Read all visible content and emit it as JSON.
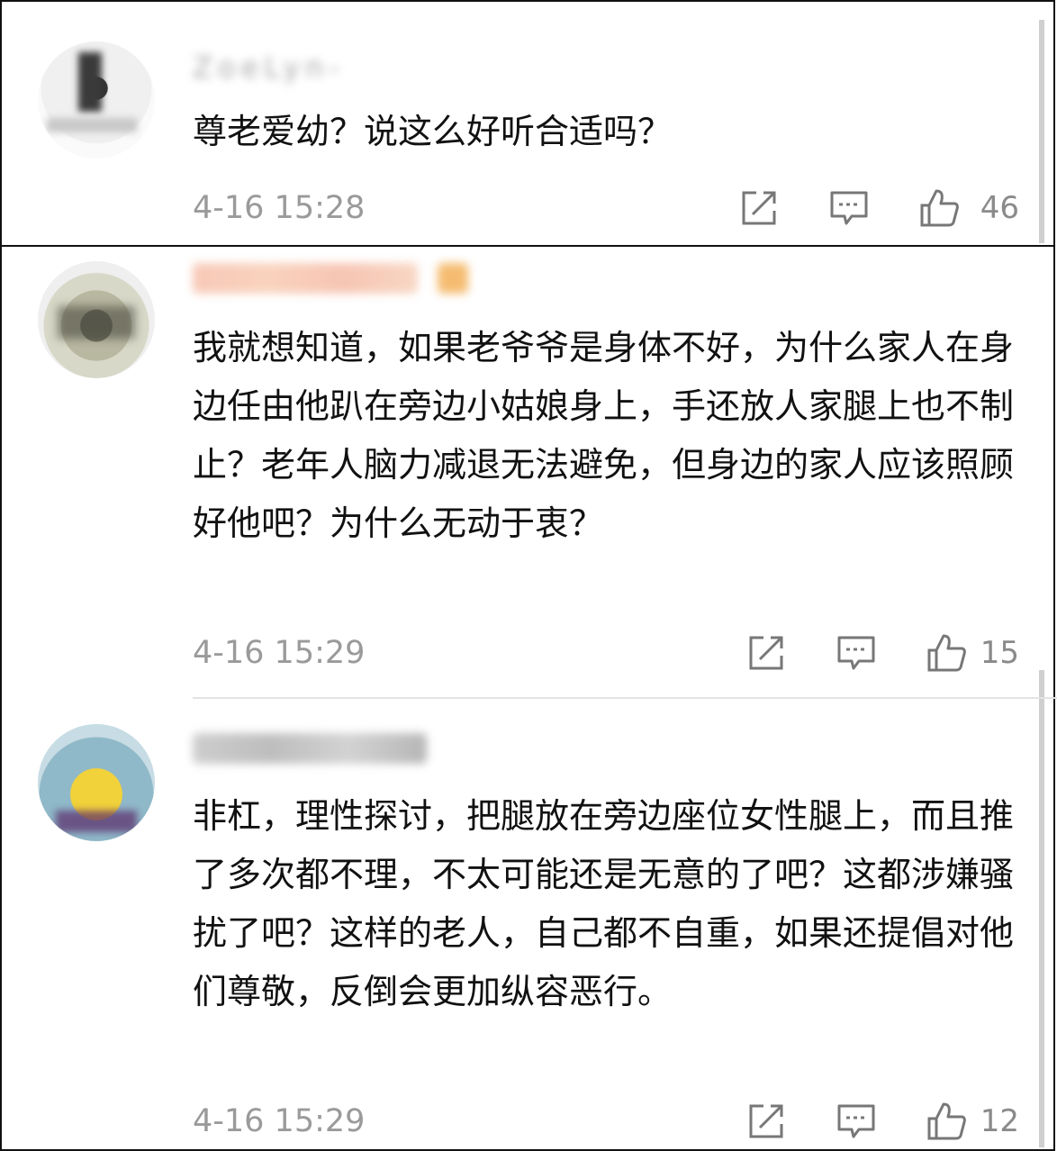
{
  "comments": [
    {
      "username": "ZoeLyn-",
      "text": "尊老爱幼？说这么好听合适吗？",
      "time": "4-16 15:28",
      "likes": "46",
      "icons": [
        "share-icon",
        "comment-icon",
        "like-icon"
      ]
    },
    {
      "username": "",
      "text": "我就想知道，如果老爷爷是身体不好，为什么家人在身边任由他趴在旁边小姑娘身上，手还放人家腿上也不制止？老年人脑力减退无法避免，但身边的家人应该照顾好他吧？为什么无动于衷？",
      "time": "4-16 15:29",
      "likes": "15",
      "icons": [
        "share-icon",
        "comment-icon",
        "like-icon"
      ]
    },
    {
      "username": "",
      "text": "非杠，理性探讨，把腿放在旁边座位女性腿上，而且推了多次都不理，不太可能还是无意的了吧？这都涉嫌骚扰了吧？这样的老人，自己都不自重，如果还提倡对他们尊敬，反倒会更加纵容恶行。",
      "time": "4-16 15:29",
      "likes": "12",
      "icons": [
        "share-icon",
        "comment-icon",
        "like-icon"
      ]
    }
  ],
  "colors": {
    "text": "#111111",
    "meta": "#9a9a9a",
    "icon": "#777777",
    "divider": "#e3e3e3"
  }
}
